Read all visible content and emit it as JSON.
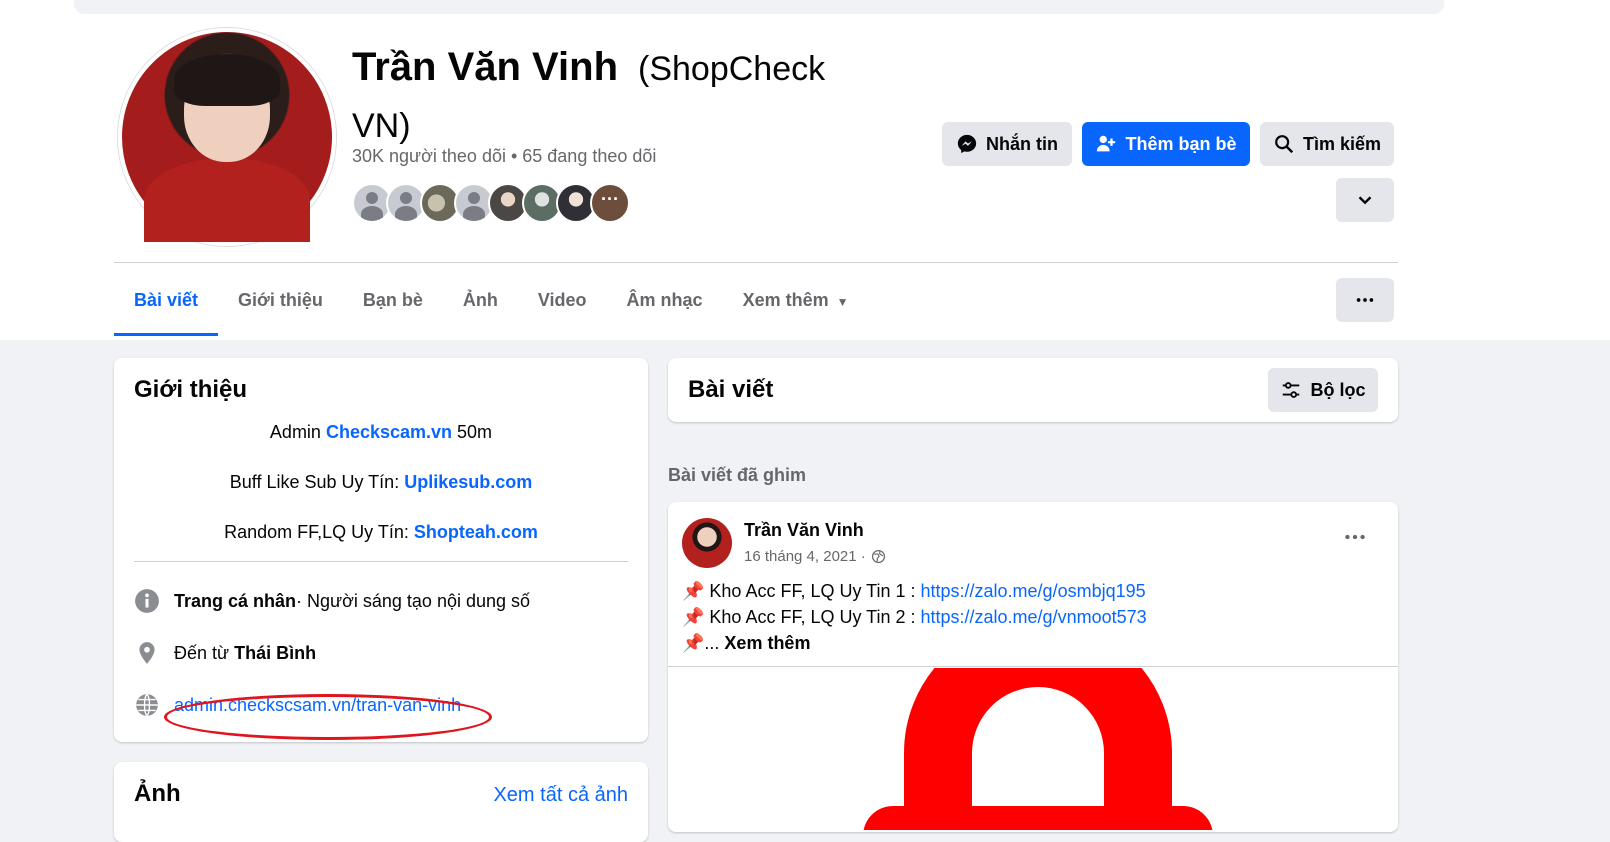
{
  "profile": {
    "name": "Trần Văn Vinh",
    "alt_name": "(ShopCheck VN)",
    "stats": "30K người theo dõi • 65 đang theo dõi",
    "friends_more": "···"
  },
  "actions": {
    "message": "Nhắn tin",
    "add_friend": "Thêm bạn bè",
    "search": "Tìm kiếm"
  },
  "tabs": [
    "Bài viết",
    "Giới thiệu",
    "Bạn bè",
    "Ảnh",
    "Video",
    "Âm nhạc",
    "Xem thêm"
  ],
  "intro": {
    "title": "Giới thiệu",
    "bio": [
      {
        "prefix": "Admin ",
        "link": "Checkscam.vn",
        "suffix": " 50m"
      },
      {
        "prefix": "Buff Like Sub Uy Tín: ",
        "link": "Uplikesub.com",
        "suffix": ""
      },
      {
        "prefix": "Random FF,LQ Uy Tín: ",
        "link": "Shopteah.com",
        "suffix": ""
      }
    ],
    "category_bold": "Trang cá nhân",
    "category_rest": " · Người sáng tạo nội dung số",
    "from_prefix": "Đến từ ",
    "from_place": "Thái Bình",
    "website": "admin.checkscsam.vn/tran-van-vinh"
  },
  "photos": {
    "title": "Ảnh",
    "see_all": "Xem tất cả ảnh"
  },
  "posts": {
    "title": "Bài viết",
    "filter": "Bộ lọc",
    "pinned_label": "Bài viết đã ghim"
  },
  "post": {
    "author": "Trần Văn Vinh",
    "date": "16 tháng 4, 2021 ·",
    "line1_text": "📌 Kho Acc FF, LQ Uy Tin 1 : ",
    "line1_link": "https://zalo.me/g/osmbjq195",
    "line2_text": "📌 Kho Acc FF, LQ Uy Tin 2 : ",
    "line2_link": "https://zalo.me/g/vnmoot573",
    "line3_text": "📌... ",
    "see_more": "Xem thêm"
  },
  "colors": {
    "accent": "#0866ff",
    "highlight": "#e0141e",
    "graphic": "#ff0000"
  }
}
